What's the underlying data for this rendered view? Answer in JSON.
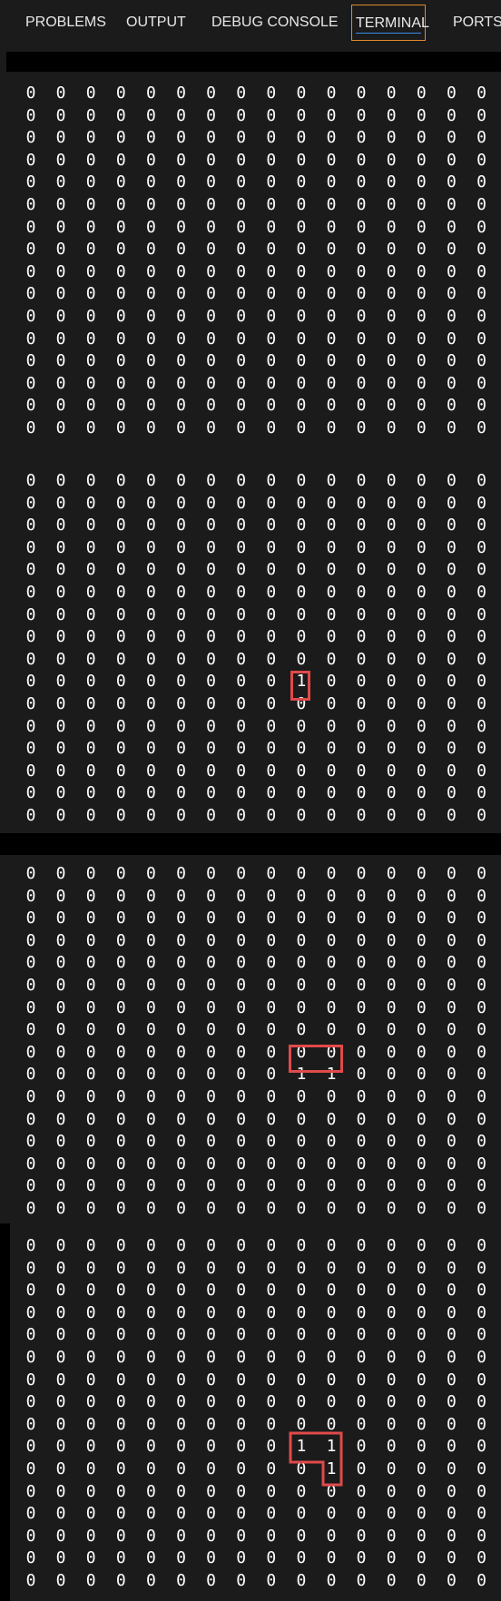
{
  "tabs": [
    {
      "label": "PROBLEMS",
      "active": false
    },
    {
      "label": "OUTPUT",
      "active": false
    },
    {
      "label": "DEBUG CONSOLE",
      "active": false
    },
    {
      "label": "TERMINAL",
      "active": true
    },
    {
      "label": "PORTS",
      "active": false
    }
  ],
  "terminal": {
    "grids": [
      {
        "rows": [
          "0 0 0 0 0 0 0 0 0 0 0 0 0 0 0 0",
          "0 0 0 0 0 0 0 0 0 0 0 0 0 0 0 0",
          "0 0 0 0 0 0 0 0 0 0 0 0 0 0 0 0",
          "0 0 0 0 0 0 0 0 0 0 0 0 0 0 0 0",
          "0 0 0 0 0 0 0 0 0 0 0 0 0 0 0 0",
          "0 0 0 0 0 0 0 0 0 0 0 0 0 0 0 0",
          "0 0 0 0 0 0 0 0 0 0 0 0 0 0 0 0",
          "0 0 0 0 0 0 0 0 0 0 0 0 0 0 0 0",
          "0 0 0 0 0 0 0 0 0 0 0 0 0 0 0 0",
          "0 0 0 0 0 0 0 0 0 0 0 0 0 0 0 0",
          "0 0 0 0 0 0 0 0 0 0 0 0 0 0 0 0",
          "0 0 0 0 0 0 0 0 0 0 0 0 0 0 0 0",
          "0 0 0 0 0 0 0 0 0 0 0 0 0 0 0 0",
          "0 0 0 0 0 0 0 0 0 0 0 0 0 0 0 0",
          "0 0 0 0 0 0 0 0 0 0 0 0 0 0 0 0",
          "0 0 0 0 0 0 0 0 0 0 0 0 0 0 0 0"
        ]
      },
      {
        "rows": [
          "0 0 0 0 0 0 0 0 0 0 0 0 0 0 0 0",
          "0 0 0 0 0 0 0 0 0 0 0 0 0 0 0 0",
          "0 0 0 0 0 0 0 0 0 0 0 0 0 0 0 0",
          "0 0 0 0 0 0 0 0 0 0 0 0 0 0 0 0",
          "0 0 0 0 0 0 0 0 0 0 0 0 0 0 0 0",
          "0 0 0 0 0 0 0 0 0 0 0 0 0 0 0 0",
          "0 0 0 0 0 0 0 0 0 0 0 0 0 0 0 0",
          "0 0 0 0 0 0 0 0 0 0 0 0 0 0 0 0",
          "0 0 0 0 0 0 0 0 0 0 0 0 0 0 0 0",
          "0 0 0 0 0 0 0 0 0 1 0 0 0 0 0 0",
          "0 0 0 0 0 0 0 0 0 0 0 0 0 0 0 0",
          "0 0 0 0 0 0 0 0 0 0 0 0 0 0 0 0",
          "0 0 0 0 0 0 0 0 0 0 0 0 0 0 0 0",
          "0 0 0 0 0 0 0 0 0 0 0 0 0 0 0 0",
          "0 0 0 0 0 0 0 0 0 0 0 0 0 0 0 0",
          "0 0 0 0 0 0 0 0 0 0 0 0 0 0 0 0"
        ]
      },
      {
        "rows": [
          "0 0 0 0 0 0 0 0 0 0 0 0 0 0 0 0",
          "0 0 0 0 0 0 0 0 0 0 0 0 0 0 0 0",
          "0 0 0 0 0 0 0 0 0 0 0 0 0 0 0 0",
          "0 0 0 0 0 0 0 0 0 0 0 0 0 0 0 0",
          "0 0 0 0 0 0 0 0 0 0 0 0 0 0 0 0",
          "0 0 0 0 0 0 0 0 0 0 0 0 0 0 0 0",
          "0 0 0 0 0 0 0 0 0 0 0 0 0 0 0 0",
          "0 0 0 0 0 0 0 0 0 0 0 0 0 0 0 0",
          "0 0 0 0 0 0 0 0 0 0 0 0 0 0 0 0",
          "0 0 0 0 0 0 0 0 0 1 1 0 0 0 0 0",
          "0 0 0 0 0 0 0 0 0 0 0 0 0 0 0 0",
          "0 0 0 0 0 0 0 0 0 0 0 0 0 0 0 0",
          "0 0 0 0 0 0 0 0 0 0 0 0 0 0 0 0",
          "0 0 0 0 0 0 0 0 0 0 0 0 0 0 0 0",
          "0 0 0 0 0 0 0 0 0 0 0 0 0 0 0 0",
          "0 0 0 0 0 0 0 0 0 0 0 0 0 0 0 0"
        ]
      },
      {
        "rows": [
          "0 0 0 0 0 0 0 0 0 0 0 0 0 0 0 0",
          "0 0 0 0 0 0 0 0 0 0 0 0 0 0 0 0",
          "0 0 0 0 0 0 0 0 0 0 0 0 0 0 0 0",
          "0 0 0 0 0 0 0 0 0 0 0 0 0 0 0 0",
          "0 0 0 0 0 0 0 0 0 0 0 0 0 0 0 0",
          "0 0 0 0 0 0 0 0 0 0 0 0 0 0 0 0",
          "0 0 0 0 0 0 0 0 0 0 0 0 0 0 0 0",
          "0 0 0 0 0 0 0 0 0 0 0 0 0 0 0 0",
          "0 0 0 0 0 0 0 0 0 0 0 0 0 0 0 0",
          "0 0 0 0 0 0 0 0 0 1 1 0 0 0 0 0",
          "0 0 0 0 0 0 0 0 0 0 1 0 0 0 0 0",
          "0 0 0 0 0 0 0 0 0 0 0 0 0 0 0 0",
          "0 0 0 0 0 0 0 0 0 0 0 0 0 0 0 0",
          "0 0 0 0 0 0 0 0 0 0 0 0 0 0 0 0",
          "0 0 0 0 0 0 0 0 0 0 0 0 0 0 0 0",
          "0 0 0 0 0 0 0 0 0 0 0 0 0 0 0 0"
        ]
      }
    ]
  },
  "colors": {
    "highlight": "#e04a4a",
    "tab_active_border": "#e08a2c",
    "text": "#ffffff",
    "background": "#1b1b1b"
  }
}
